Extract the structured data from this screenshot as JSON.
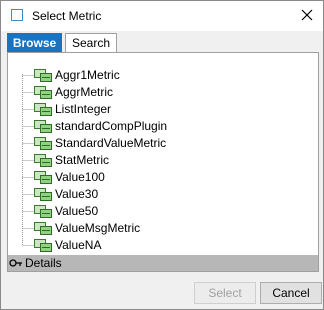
{
  "window": {
    "title": "Select Metric"
  },
  "tabs": [
    {
      "label": "Browse",
      "active": true
    },
    {
      "label": "Search",
      "active": false
    }
  ],
  "tree": {
    "items": [
      "Aggr1Metric",
      "AggrMetric",
      "ListInteger",
      "standardCompPlugin",
      "StandardValueMetric",
      "StatMetric",
      "Value100",
      "Value30",
      "Value50",
      "ValueMsgMetric",
      "ValueNA"
    ],
    "item_icon": "metric-icon"
  },
  "details": {
    "label": "Details",
    "icon": "key-icon"
  },
  "buttons": {
    "select": "Select",
    "cancel": "Cancel"
  },
  "colors": {
    "accent": "#1a73c1",
    "details_bar": "#b7b7b7"
  }
}
